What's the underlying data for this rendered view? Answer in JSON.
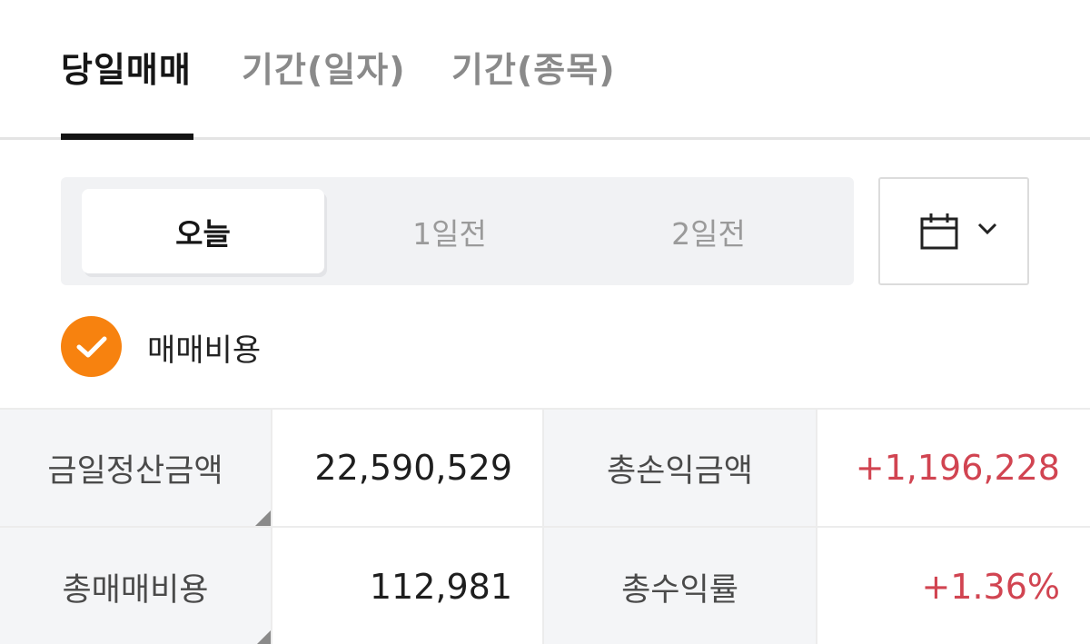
{
  "tabs": [
    {
      "label": "당일매매",
      "active": true
    },
    {
      "label": "기간(일자)",
      "active": false
    },
    {
      "label": "기간(종목)",
      "active": false
    }
  ],
  "day_selector": {
    "options": [
      "오늘",
      "1일전",
      "2일전"
    ],
    "selected": "오늘"
  },
  "calendar_button": {
    "icon": "calendar-icon",
    "dropdown_icon": "chevron-down-icon"
  },
  "fee_checkbox": {
    "label": "매매비용",
    "checked": true,
    "color": "#f7820f"
  },
  "summary": {
    "settlement_label": "금일정산금액",
    "settlement_value": "22,590,529",
    "total_pl_label": "총손익금액",
    "total_pl_value": "+1,196,228",
    "total_fee_label": "총매매비용",
    "total_fee_value": "112,981",
    "return_rate_label": "총수익률",
    "return_rate_value": "+1.36%"
  },
  "colors": {
    "positive": "#d14451",
    "accent": "#f7820f",
    "active_text": "#161616"
  }
}
